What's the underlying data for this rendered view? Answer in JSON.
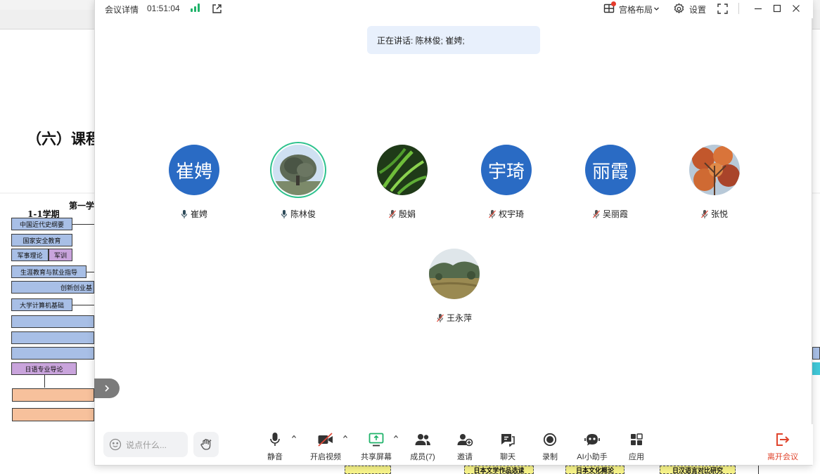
{
  "document": {
    "heading": "（六）课程",
    "semester_title": "第一学",
    "term_label": "1-1学期",
    "boxes": [
      {
        "label": "中国近代史纲要"
      },
      {
        "label": "国家安全教育"
      },
      {
        "label": "军事理论"
      },
      {
        "label": "军训"
      },
      {
        "label": "生涯教育与就业指导"
      },
      {
        "label": "创新创业基"
      },
      {
        "label": "大学计算机基础"
      },
      {
        "label": "日语专业导论"
      },
      {
        "label": "日本文学作品选读"
      },
      {
        "label": "日本文化概论"
      },
      {
        "label": "日汉语言对比研究"
      }
    ]
  },
  "titlebar": {
    "meeting_details": "会议详情",
    "timer": "01:51:04",
    "layout_label": "宫格布局",
    "settings_label": "设置"
  },
  "speaking_banner": "正在讲话: 陈林俊; 崔娉;",
  "participants": [
    {
      "name": "崔娉",
      "avatar_text": "崔娉",
      "mic": "active"
    },
    {
      "name": "陈林俊",
      "avatar_text": "",
      "mic": "active"
    },
    {
      "name": "殷娟",
      "avatar_text": "",
      "mic": "muted"
    },
    {
      "name": "权宇琦",
      "avatar_text": "宇琦",
      "mic": "muted"
    },
    {
      "name": "吴丽霞",
      "avatar_text": "丽霞",
      "mic": "muted"
    },
    {
      "name": "张悦",
      "avatar_text": "",
      "mic": "muted"
    },
    {
      "name": "王永萍",
      "avatar_text": "",
      "mic": "muted"
    }
  ],
  "toolbar": {
    "chat_placeholder": "说点什么...",
    "mute": "静音",
    "video": "开启视频",
    "share": "共享屏幕",
    "members": "成员(7)",
    "invite": "邀请",
    "chat": "聊天",
    "record": "录制",
    "ai": "AI小助手",
    "apps": "应用",
    "leave": "离开会议"
  },
  "colors": {
    "accent_green": "#1fb36a",
    "avatar_blue": "#2a6bc4",
    "leave_red": "#e0442c",
    "muted_red": "#e04a3a"
  }
}
